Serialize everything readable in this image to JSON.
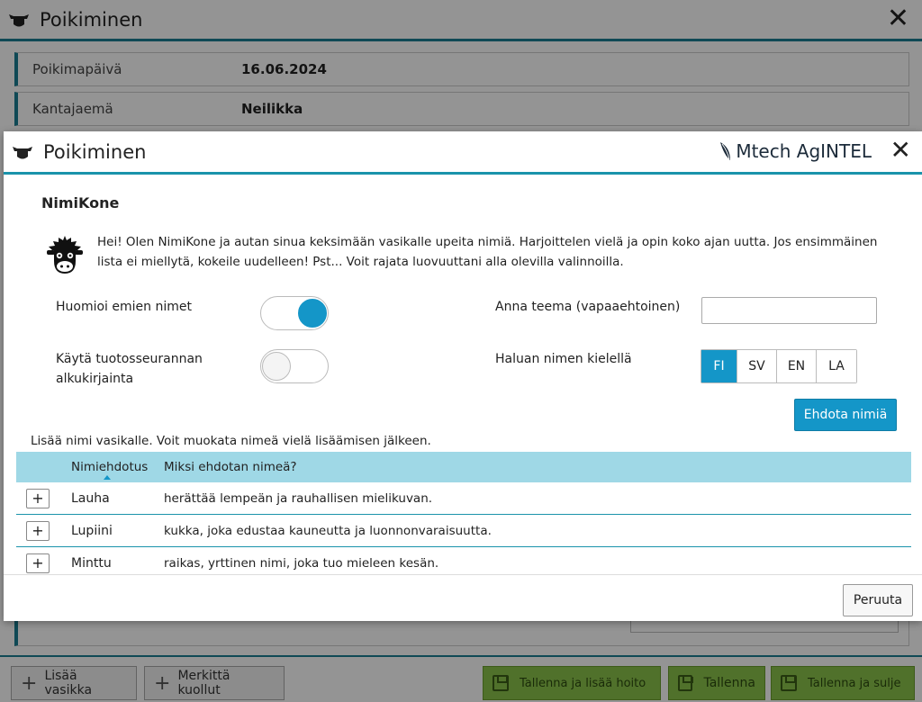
{
  "background": {
    "title": "Poikiminen",
    "fields": [
      {
        "label": "Poikimapäivä",
        "value": "16.06.2024"
      },
      {
        "label": "Kantajaemä",
        "value": "Neilikka"
      }
    ],
    "footer_buttons": {
      "add_calf": "Lisää vasikka",
      "mark_dead": "Merkittä kuollut",
      "save_add_treatment": "Tallenna ja lisää hoito",
      "save": "Tallenna",
      "save_close": "Tallenna ja sulje"
    }
  },
  "dialog": {
    "title": "Poikiminen",
    "brand": "Mtech AgINTEL",
    "section_title": "NimiKone",
    "intro": "Hei! Olen NimiKone ja autan sinua keksimään vasikalle upeita nimiä. Harjoittelen vielä ja opin koko ajan uutta. Jos ensimmäinen lista ei miellytä, kokeile uudelleen! Pst... Voit rajata luovuuttani alla olevilla valinnoilla.",
    "options": {
      "mother_names_label": "Huomioi emien nimet",
      "mother_names_on": true,
      "initial_label": "Käytä tuotosseurannan alkukirjainta",
      "initial_on": false,
      "theme_label": "Anna teema (vapaaehtoinen)",
      "theme_value": "",
      "language_label": "Haluan nimen kielellä",
      "languages": [
        "FI",
        "SV",
        "EN",
        "LA"
      ],
      "selected_language": "FI"
    },
    "suggest_button": "Ehdota nimiä",
    "add_hint": "Lisää nimi vasikalle. Voit muokata nimeä vielä lisäämisen jälkeen.",
    "table": {
      "headers": {
        "name": "Nimiehdotus",
        "why": "Miksi ehdotan nimeä?"
      },
      "rows": [
        {
          "name": "Lauha",
          "why": "herättää lempeän ja rauhallisen mielikuvan."
        },
        {
          "name": "Lupiini",
          "why": "kukka, joka edustaa kauneutta ja luonnonvaraisuutta."
        },
        {
          "name": "Minttu",
          "why": "raikas, yrttinen nimi, joka tuo mieleen kesän."
        }
      ]
    },
    "cancel_button": "Peruuta"
  },
  "colors": {
    "accent": "#1496c8",
    "header_line": "#1a93ab",
    "table_header": "#9fd8e6",
    "save_green": "#8bc34a"
  }
}
